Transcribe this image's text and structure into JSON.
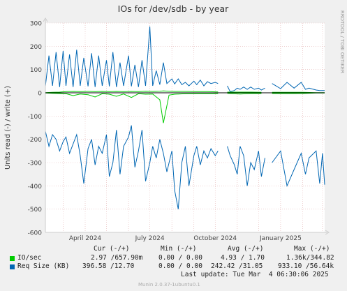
{
  "chart_data": {
    "type": "line",
    "title": "IOs for /dev/sdb - by year",
    "ylabel": "Units read (-) / write (+)",
    "side_label": "RRDTOOL / TOBI OETIKER",
    "ylim": [
      -600,
      300
    ],
    "yticks": [
      300,
      200,
      100,
      0,
      -100,
      -200,
      -300,
      -400,
      -500,
      -600
    ],
    "xlim": [
      "2024-02-05",
      "2025-03-04"
    ],
    "xticks": [
      {
        "label": "April 2024",
        "date": "2024-04-01"
      },
      {
        "label": "July 2024",
        "date": "2024-07-01"
      },
      {
        "label": "October 2024",
        "date": "2024-10-01"
      },
      {
        "label": "January 2025",
        "date": "2025-01-01"
      }
    ],
    "grid": true,
    "series": [
      {
        "name": "IO/sec",
        "color": "#00cc00",
        "points": [
          [
            "2024-02-05",
            1,
            -1
          ],
          [
            "2024-02-15",
            2,
            -2
          ],
          [
            "2024-02-25",
            3,
            -3
          ],
          [
            "2024-03-05",
            5,
            -4
          ],
          [
            "2024-03-15",
            6,
            -12
          ],
          [
            "2024-03-25",
            5,
            -5
          ],
          [
            "2024-04-05",
            6,
            -8
          ],
          [
            "2024-04-15",
            5,
            -18
          ],
          [
            "2024-04-25",
            6,
            -4
          ],
          [
            "2024-05-05",
            5,
            -6
          ],
          [
            "2024-05-15",
            6,
            -15
          ],
          [
            "2024-05-25",
            5,
            -5
          ],
          [
            "2024-06-05",
            6,
            -20
          ],
          [
            "2024-06-15",
            5,
            -4
          ],
          [
            "2024-06-25",
            7,
            -6
          ],
          [
            "2024-07-05",
            6,
            -5
          ],
          [
            "2024-07-15",
            7,
            -30
          ],
          [
            "2024-07-20",
            8,
            -130
          ],
          [
            "2024-07-28",
            7,
            -10
          ],
          [
            "2024-08-05",
            6,
            -6
          ],
          [
            "2024-08-20",
            6,
            -4
          ],
          [
            "2024-09-05",
            5,
            -3
          ],
          [
            "2024-09-20",
            5,
            -3
          ],
          [
            "2024-10-05",
            4,
            -3
          ],
          [
            "2024-10-10",
            null,
            null
          ],
          [
            "2024-10-18",
            3,
            -2
          ],
          [
            "2024-11-05",
            3,
            -5
          ],
          [
            "2024-11-20",
            3,
            -3
          ],
          [
            "2024-12-05",
            2,
            -3
          ],
          [
            "2024-12-15",
            null,
            null
          ],
          [
            "2024-12-20",
            2,
            -3
          ],
          [
            "2025-01-10",
            2,
            -4
          ],
          [
            "2025-02-01",
            2,
            -3
          ],
          [
            "2025-02-20",
            1,
            -1
          ],
          [
            "2025-03-04",
            1,
            -1
          ]
        ]
      },
      {
        "name": "Req Size (KB)",
        "color": "#0066b3",
        "points": [
          [
            "2024-02-05",
            28,
            -165
          ],
          [
            "2024-02-10",
            160,
            -230
          ],
          [
            "2024-02-15",
            30,
            -180
          ],
          [
            "2024-02-20",
            175,
            -200
          ],
          [
            "2024-02-25",
            25,
            -250
          ],
          [
            "2024-03-01",
            180,
            -210
          ],
          [
            "2024-03-05",
            30,
            -190
          ],
          [
            "2024-03-10",
            165,
            -260
          ],
          [
            "2024-03-15",
            25,
            -220
          ],
          [
            "2024-03-20",
            185,
            -180
          ],
          [
            "2024-03-25",
            30,
            -270
          ],
          [
            "2024-03-30",
            150,
            -390
          ],
          [
            "2024-04-05",
            28,
            -240
          ],
          [
            "2024-04-10",
            170,
            -200
          ],
          [
            "2024-04-15",
            25,
            -310
          ],
          [
            "2024-04-20",
            160,
            -230
          ],
          [
            "2024-04-25",
            30,
            -260
          ],
          [
            "2024-05-01",
            140,
            -180
          ],
          [
            "2024-05-05",
            28,
            -360
          ],
          [
            "2024-05-10",
            175,
            -300
          ],
          [
            "2024-05-15",
            25,
            -160
          ],
          [
            "2024-05-20",
            130,
            -350
          ],
          [
            "2024-05-25",
            30,
            -230
          ],
          [
            "2024-06-01",
            160,
            -190
          ],
          [
            "2024-06-05",
            28,
            -140
          ],
          [
            "2024-06-10",
            120,
            -320
          ],
          [
            "2024-06-15",
            25,
            -250
          ],
          [
            "2024-06-20",
            140,
            -160
          ],
          [
            "2024-06-25",
            30,
            -380
          ],
          [
            "2024-07-01",
            285,
            -300
          ],
          [
            "2024-07-05",
            30,
            -230
          ],
          [
            "2024-07-10",
            95,
            -280
          ],
          [
            "2024-07-15",
            35,
            -200
          ],
          [
            "2024-07-20",
            130,
            -260
          ],
          [
            "2024-07-25",
            40,
            -340
          ],
          [
            "2024-08-01",
            60,
            -250
          ],
          [
            "2024-08-05",
            38,
            -420
          ],
          [
            "2024-08-10",
            60,
            -500
          ],
          [
            "2024-08-15",
            35,
            -300
          ],
          [
            "2024-08-20",
            45,
            -230
          ],
          [
            "2024-08-25",
            30,
            -400
          ],
          [
            "2024-09-01",
            50,
            -270
          ],
          [
            "2024-09-05",
            35,
            -230
          ],
          [
            "2024-09-10",
            55,
            -310
          ],
          [
            "2024-09-15",
            30,
            -250
          ],
          [
            "2024-09-20",
            48,
            -280
          ],
          [
            "2024-09-25",
            40,
            -240
          ],
          [
            "2024-10-01",
            45,
            -270
          ],
          [
            "2024-10-05",
            40,
            -250
          ],
          [
            "2024-10-10",
            null,
            null
          ],
          [
            "2024-10-18",
            30,
            -230
          ],
          [
            "2024-10-22",
            5,
            -270
          ],
          [
            "2024-10-28",
            10,
            -310
          ],
          [
            "2024-11-01",
            20,
            -350
          ],
          [
            "2024-11-05",
            15,
            -230
          ],
          [
            "2024-11-10",
            25,
            -270
          ],
          [
            "2024-11-15",
            15,
            -400
          ],
          [
            "2024-11-20",
            25,
            -300
          ],
          [
            "2024-11-25",
            15,
            -330
          ],
          [
            "2024-12-01",
            20,
            -250
          ],
          [
            "2024-12-05",
            12,
            -360
          ],
          [
            "2024-12-10",
            20,
            -280
          ],
          [
            "2024-12-15",
            null,
            null
          ],
          [
            "2024-12-20",
            40,
            -300
          ],
          [
            "2025-01-01",
            18,
            -250
          ],
          [
            "2025-01-10",
            45,
            -400
          ],
          [
            "2025-01-20",
            20,
            -330
          ],
          [
            "2025-01-30",
            45,
            -260
          ],
          [
            "2025-02-05",
            15,
            -350
          ],
          [
            "2025-02-10",
            20,
            -280
          ],
          [
            "2025-02-20",
            12,
            -250
          ],
          [
            "2025-02-25",
            10,
            -390
          ],
          [
            "2025-03-01",
            10,
            -260
          ],
          [
            "2025-03-04",
            10,
            -395
          ]
        ]
      }
    ]
  },
  "legend": {
    "headers": {
      "cur": "Cur (-/+)",
      "min": "Min (-/+)",
      "avg": "Avg (-/+)",
      "max": "Max (-/+)"
    },
    "rows": [
      {
        "name": "IO/sec",
        "color": "#00cc00",
        "cur": "2.97 /657.90m",
        "min": "0.00 / 0.00",
        "avg": "4.93 / 1.70",
        "max": "1.36k/344.82"
      },
      {
        "name": "Req Size (KB)",
        "color": "#0066b3",
        "cur": "396.58 /12.70",
        "min": "0.00 / 0.00",
        "avg": "242.42 /31.05",
        "max": "933.10 /56.64k"
      }
    ],
    "last_update": "Last update: Tue Mar  4 06:30:06 2025"
  },
  "footer": "Munin 2.0.37-1ubuntu0.1"
}
